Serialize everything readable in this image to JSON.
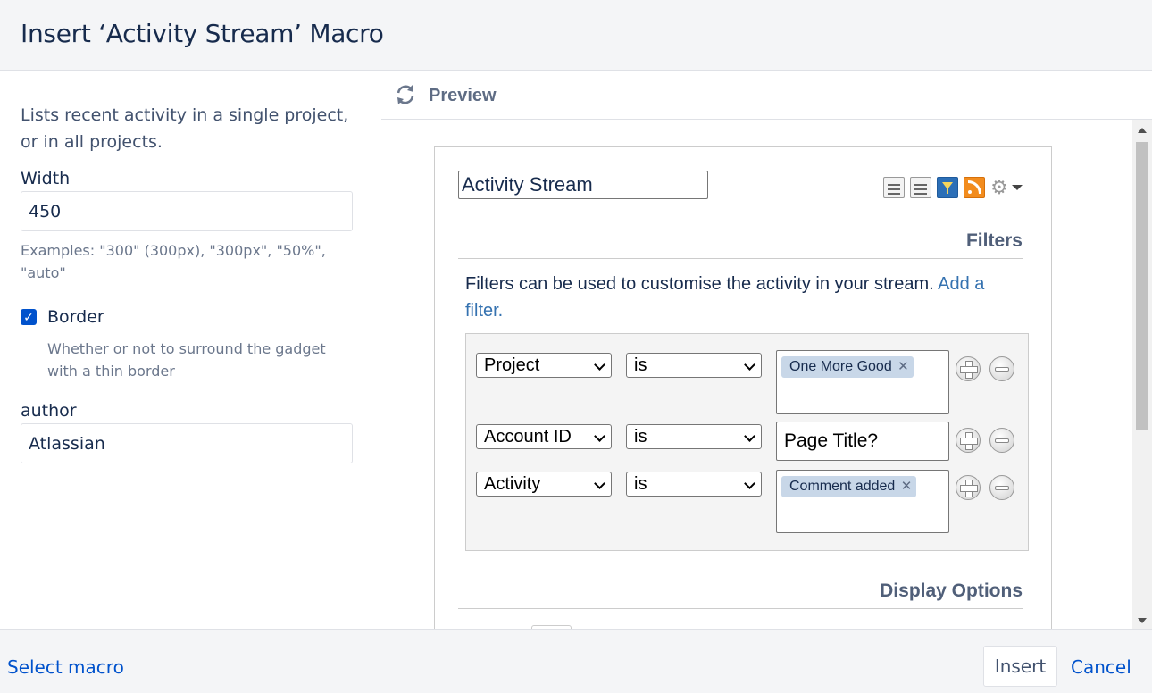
{
  "dialog": {
    "title": "Insert ‘Activity Stream’ Macro"
  },
  "left": {
    "description": "Lists recent activity in a single project, or in all projects.",
    "width_label": "Width",
    "width_value": "450",
    "width_help": "Examples: \"300\" (300px), \"300px\", \"50%\", \"auto\"",
    "border_label": "Border",
    "border_checked": true,
    "border_help": "Whether or not to surround the gadget with a thin border",
    "author_label": "author",
    "author_value": "Atlassian"
  },
  "preview": {
    "label": "Preview",
    "gadget": {
      "title_value": "Activity Stream",
      "filters_heading": "Filters",
      "filters_text": "Filters can be used to customise the activity in your stream.",
      "add_filter_link": "Add a filter.",
      "filters": [
        {
          "field": "Project",
          "operator": "is",
          "tag": "One More Good",
          "text": ""
        },
        {
          "field": "Account ID",
          "operator": "is",
          "tag": "",
          "text": "Page Title?"
        },
        {
          "field": "Activity",
          "operator": "is",
          "tag": "Comment added",
          "text": ""
        }
      ],
      "display_options_heading": "Display Options"
    }
  },
  "footer": {
    "select_macro": "Select macro",
    "insert": "Insert",
    "cancel": "Cancel"
  },
  "colors": {
    "link": "#0052cc",
    "checkbox": "#0052cc",
    "tag_bg": "#c8d7e8"
  }
}
